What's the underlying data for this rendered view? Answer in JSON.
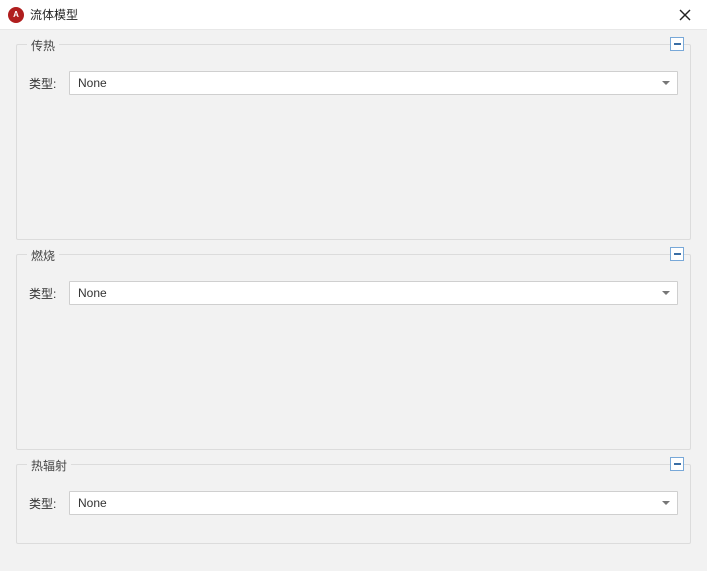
{
  "window": {
    "title": "流体模型",
    "app_icon_text": "A"
  },
  "groups": {
    "heat": {
      "legend": "传热",
      "type_label": "类型:",
      "type_value": "None"
    },
    "combustion": {
      "legend": "燃烧",
      "type_label": "类型:",
      "type_value": "None"
    },
    "radiation": {
      "legend": "热辐射",
      "type_label": "类型:",
      "type_value": "None"
    }
  }
}
